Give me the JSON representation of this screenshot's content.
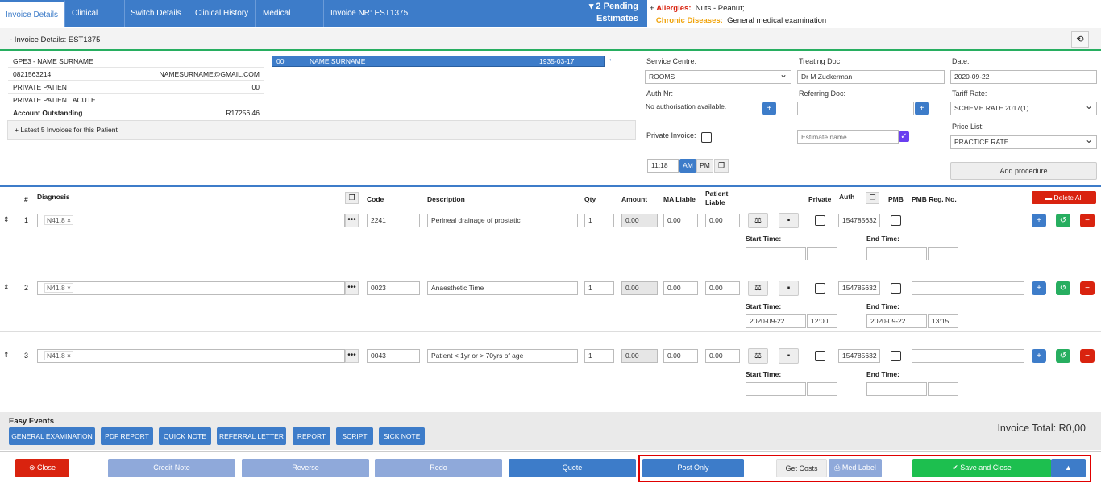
{
  "tabs": [
    {
      "label": "Invoice Details"
    },
    {
      "label": "Clinical Case"
    },
    {
      "label": "Switch Details"
    },
    {
      "label": "Clinical History"
    },
    {
      "label": "Medical History"
    },
    {
      "label": "Invoice NR: EST1375"
    }
  ],
  "pending": {
    "line1": "▾ 2 Pending",
    "line2": "Estimates"
  },
  "allergies": {
    "prefix": "+ ",
    "label": "Allergies:",
    "value": "Nuts - Peanut;"
  },
  "chronic": {
    "label": "Chronic Diseases:",
    "value": "General medical examination"
  },
  "section": {
    "title": "- Invoice Details: EST1375"
  },
  "patient": {
    "code_name": "GPE3 -  NAME SURNAME",
    "phone": "0821563214",
    "email": "NAMESURNAME@GMAIL.COM",
    "type": "PRIVATE PATIENT",
    "type_code": "00",
    "type2": "PRIVATE PATIENT ACUTE",
    "outstanding_label": "Account Outstanding",
    "outstanding_value": "R17256,46",
    "latest": "+ Latest 5 Invoices for this Patient"
  },
  "selected_patient": {
    "code": "00",
    "name": "NAME SURNAME",
    "dob": "1935-03-17"
  },
  "form": {
    "service_centre_label": "Service Centre:",
    "service_centre": "ROOMS",
    "treating_doc_label": "Treating Doc:",
    "treating_doc": "Dr M Zuckerman",
    "date_label": "Date:",
    "date": "2020-09-22",
    "auth_label": "Auth Nr:",
    "auth_value": "No authorisation available.",
    "referring_label": "Referring Doc:",
    "referring": "",
    "tariff_label": "Tariff Rate:",
    "tariff": "SCHEME RATE 2017(1)",
    "private_label": "Private Invoice:",
    "estimate_placeholder": "Estimate name ...",
    "price_list_label": "Price List:",
    "price_list": "PRACTICE RATE",
    "time": "11:18",
    "am": "AM",
    "pm": "PM",
    "add_procedure": "Add procedure"
  },
  "columns": {
    "num": "#",
    "diagnosis": "Diagnosis",
    "code": "Code",
    "description": "Description",
    "qty": "Qty",
    "amount": "Amount",
    "ma": "MA Liable",
    "patient": "Patient Liable",
    "private": "Private",
    "auth": "Auth",
    "pmb": "PMB",
    "pmb_reg": "PMB Reg. No.",
    "delete_all": "Delete All"
  },
  "rows": [
    {
      "num": "1",
      "diag": "N41.8",
      "code": "2241",
      "desc": "Perineal drainage of prostatic",
      "qty": "1",
      "amount": "0.00",
      "ma": "0.00",
      "pat": "0.00",
      "auth": "154785632",
      "start_label": "Start Time:",
      "end_label": "End Time:",
      "start_date": "",
      "start_time": "",
      "end_date": "",
      "end_time": ""
    },
    {
      "num": "2",
      "diag": "N41.8",
      "code": "0023",
      "desc": "Anaesthetic Time",
      "qty": "1",
      "amount": "0.00",
      "ma": "0.00",
      "pat": "0.00",
      "auth": "154785632",
      "start_label": "Start Time:",
      "end_label": "End Time:",
      "start_date": "2020-09-22",
      "start_time": "12:00",
      "end_date": "2020-09-22",
      "end_time": "13:15"
    },
    {
      "num": "3",
      "diag": "N41.8",
      "code": "0043",
      "desc": "Patient < 1yr or > 70yrs of age",
      "qty": "1",
      "amount": "0.00",
      "ma": "0.00",
      "pat": "0.00",
      "auth": "154785632",
      "start_label": "Start Time:",
      "end_label": "End Time:",
      "start_date": "",
      "start_time": "",
      "end_date": "",
      "end_time": ""
    }
  ],
  "easy": {
    "title": "Easy Events",
    "buttons": [
      "GENERAL EXAMINATION",
      "PDF REPORT",
      "QUICK NOTE",
      "REFERRAL LETTER",
      "REPORT",
      "SCRIPT",
      "SICK NOTE"
    ],
    "total": "Invoice Total: R0,00"
  },
  "footer": {
    "close": "Close",
    "credit": "Credit Note",
    "reverse": "Reverse",
    "redo": "Redo",
    "quote": "Quote",
    "post": "Post Only",
    "costs": "Get Costs",
    "med": "Med Label",
    "save": "Save and Close"
  },
  "colors": {
    "primary": "#3d7cc9",
    "success": "#27ae60",
    "danger": "#d9230f",
    "highlight": "#e00000"
  }
}
